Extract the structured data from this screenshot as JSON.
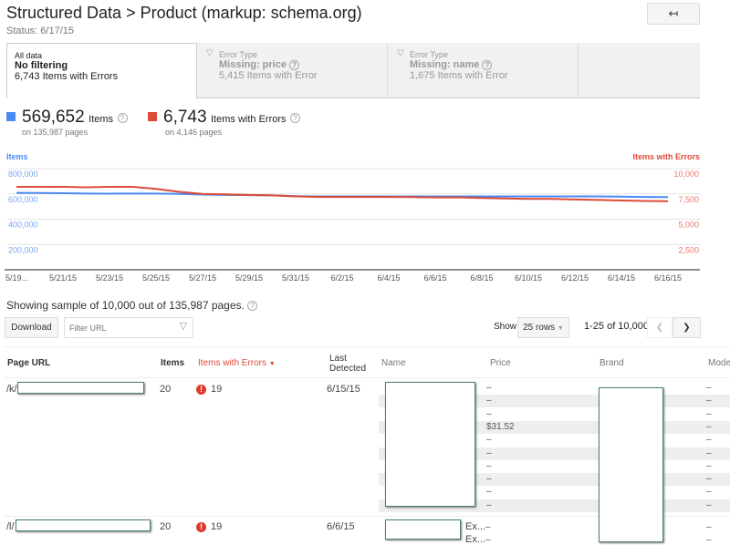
{
  "header": {
    "title": "Structured Data > Product (markup: schema.org)",
    "status": "Status: 6/17/15",
    "back_icon": "back-arrow-icon"
  },
  "tabs": [
    {
      "small": "All data",
      "bold": "No filtering",
      "count": "6,743 Items with Errors"
    },
    {
      "small": "Error Type",
      "bold": "Missing: price",
      "count": "5,415 Items with Error"
    },
    {
      "small": "Error Type",
      "bold": "Missing: name",
      "count": "1,675 Items with Error"
    }
  ],
  "summary": {
    "items_value": "569,652",
    "items_label": "Items",
    "items_pages": "on 135,987 pages",
    "errors_value": "6,743",
    "errors_label": "Items with Errors",
    "errors_pages": "on 4,146 pages",
    "items_color": "#4a8af4",
    "errors_color": "#dd4b39"
  },
  "chart_data": {
    "type": "line",
    "ylabel_left": "Items",
    "ylabel_right": "Items with Errors",
    "ylim_left": [
      0,
      800000
    ],
    "ylim_right": [
      0,
      10000
    ],
    "yticks_left": [
      "800,000",
      "600,000",
      "400,000",
      "200,000"
    ],
    "yticks_right": [
      "10,000",
      "7,500",
      "5,000",
      "2,500"
    ],
    "xticks": [
      "5/19...",
      "5/21/15",
      "5/23/15",
      "5/25/15",
      "5/27/15",
      "5/29/15",
      "5/31/15",
      "6/2/15",
      "6/4/15",
      "6/6/15",
      "6/8/15",
      "6/10/15",
      "6/12/15",
      "6/14/15",
      "6/16/15"
    ],
    "grid": true,
    "x": [
      "5/19",
      "5/20",
      "5/21",
      "5/22",
      "5/23",
      "5/24",
      "5/25",
      "5/26",
      "5/27",
      "5/28",
      "5/29",
      "5/30",
      "5/31",
      "6/1",
      "6/2",
      "6/3",
      "6/4",
      "6/5",
      "6/6",
      "6/7",
      "6/8",
      "6/9",
      "6/10",
      "6/11",
      "6/12",
      "6/13",
      "6/14",
      "6/15",
      "6/16"
    ],
    "series": [
      {
        "name": "Items",
        "axis": "left",
        "color": "#4a8af4",
        "values": [
          608000,
          607000,
          605000,
          603000,
          602000,
          603000,
          603000,
          600000,
          595000,
          592000,
          590000,
          588000,
          582000,
          580000,
          580000,
          580000,
          580000,
          580000,
          580000,
          580000,
          580000,
          580000,
          580000,
          580000,
          580000,
          580000,
          578000,
          576000,
          575000
        ]
      },
      {
        "name": "Items with Errors",
        "axis": "right",
        "color": "#dd4b39",
        "values": [
          8200,
          8200,
          8200,
          8150,
          8200,
          8200,
          8000,
          7700,
          7500,
          7450,
          7400,
          7350,
          7250,
          7200,
          7200,
          7200,
          7200,
          7180,
          7150,
          7150,
          7100,
          7050,
          7000,
          7000,
          6950,
          6900,
          6850,
          6800,
          6780
        ]
      }
    ]
  },
  "table_controls": {
    "sample_text": "Showing sample of 10,000 out of 135,987 pages.",
    "download": "Download",
    "filter_placeholder": "Filter URL",
    "show_label": "Show",
    "rows_select": "25 rows",
    "range": "1-25 of 10,000"
  },
  "columns": [
    "Page URL",
    "Items",
    "Items with Errors",
    "Last Detected",
    "Name",
    "Price",
    "Brand",
    "Mode"
  ],
  "rows": [
    {
      "url_prefix": "/k/",
      "items": "20",
      "errors": "19",
      "last": "6/15/15",
      "prices": [
        "–",
        "–",
        "–",
        "$31.52",
        "–",
        "–",
        "–",
        "–",
        "–",
        "–"
      ],
      "models": [
        "–",
        "–",
        "–",
        "–",
        "–",
        "–",
        "–",
        "–",
        "–",
        "–"
      ]
    },
    {
      "url_prefix": "/l/",
      "items": "20",
      "errors": "19",
      "last": "6/6/15",
      "name_frag": [
        "Ex...",
        "Ex..."
      ],
      "prices": [
        "–",
        "–"
      ],
      "models": [
        "–",
        "–"
      ]
    }
  ]
}
